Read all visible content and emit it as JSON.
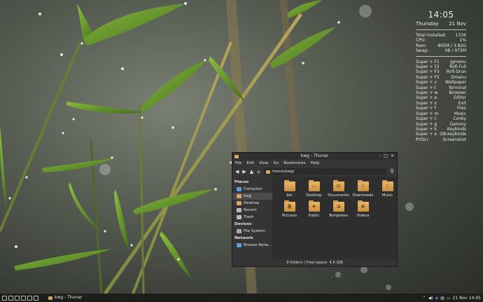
{
  "conky": {
    "time": "14:05",
    "day": "Thursday",
    "date": "21 Nov",
    "stats": [
      {
        "label": "Total Installed:",
        "value": "1334"
      },
      {
        "label": "CPU:",
        "value": "1%"
      },
      {
        "label": "Ram:",
        "value": "805M  / 3.82G"
      },
      {
        "label": "Swap:",
        "value": "0B  / 975M"
      }
    ],
    "keybinds": [
      {
        "key": "Super + F1",
        "action": "Jgmenu"
      },
      {
        "key": "Super + F2",
        "action": "Rofi-Full"
      },
      {
        "key": "Super + F3",
        "action": "Rofi-Drun"
      },
      {
        "key": "Super + F5",
        "action": "Dmenu"
      },
      {
        "key": "Super + v",
        "action": "Wallpaper"
      },
      {
        "key": "Super + t",
        "action": "Terminal"
      },
      {
        "key": "Super + w",
        "action": "Browser"
      },
      {
        "key": "Super + e",
        "action": "Editor"
      },
      {
        "key": "Super + x",
        "action": "Exit"
      },
      {
        "key": "Super + f",
        "action": "Files"
      },
      {
        "key": "Super + m",
        "action": "Music"
      },
      {
        "key": "Super + c",
        "action": "Conky"
      },
      {
        "key": "Super + g",
        "action": "Gammy"
      },
      {
        "key": "Super + k",
        "action": "Keybinds"
      },
      {
        "key": "Super + o",
        "action": "OB-keybinds"
      },
      {
        "key": "PrtScr",
        "action": "Screenshot"
      }
    ]
  },
  "thunar": {
    "title": "kwg - Thunar",
    "window_buttons": [
      "–",
      "□",
      "✕"
    ],
    "menu": [
      "File",
      "Edit",
      "View",
      "Go",
      "Bookmarks",
      "Help"
    ],
    "toolbar_icons": [
      "back-arrow-icon",
      "forward-arrow-icon",
      "up-arrow-icon",
      "home-icon"
    ],
    "location": "/home/kwg/",
    "sidebar": {
      "places_header": "Places",
      "places": [
        {
          "label": "Computer",
          "icon": "computer-icon",
          "color": "#5aa0e0"
        },
        {
          "label": "kwg",
          "icon": "home-icon",
          "color": "#d9a45b"
        },
        {
          "label": "Desktop",
          "icon": "desktop-folder-icon",
          "color": "#d9a45b"
        },
        {
          "label": "Recent",
          "icon": "clock-icon",
          "color": "#bbbbbb"
        },
        {
          "label": "Trash",
          "icon": "trash-icon",
          "color": "#bbbbbb"
        }
      ],
      "devices_header": "Devices",
      "devices": [
        {
          "label": "File System",
          "icon": "drive-icon",
          "color": "#aaaaaa"
        }
      ],
      "network_header": "Network",
      "network": [
        {
          "label": "Browse Netw...",
          "icon": "network-icon",
          "color": "#5aa0e0"
        }
      ]
    },
    "files": [
      {
        "label": "bin",
        "icon": "folder-icon",
        "glyph": ""
      },
      {
        "label": "Desktop",
        "icon": "desktop-folder-icon",
        "glyph": "▭"
      },
      {
        "label": "Documents",
        "icon": "documents-folder-icon",
        "glyph": "▤"
      },
      {
        "label": "Downloads",
        "icon": "downloads-folder-icon",
        "glyph": "↓"
      },
      {
        "label": "Music",
        "icon": "music-folder-icon",
        "glyph": "♪"
      },
      {
        "label": "Pictures",
        "icon": "pictures-folder-icon",
        "glyph": "◙"
      },
      {
        "label": "Public",
        "icon": "public-folder-icon",
        "glyph": "◉"
      },
      {
        "label": "Templates",
        "icon": "templates-folder-icon",
        "glyph": "◪"
      },
      {
        "label": "Videos",
        "icon": "videos-folder-icon",
        "glyph": "▣"
      }
    ],
    "status": "9 folders  |  Free space: 4.6 GiB"
  },
  "taskbar": {
    "task_label": "kwg - Thunar",
    "clock": "21 Nov 14:05",
    "accent": "#3aa8d8"
  }
}
